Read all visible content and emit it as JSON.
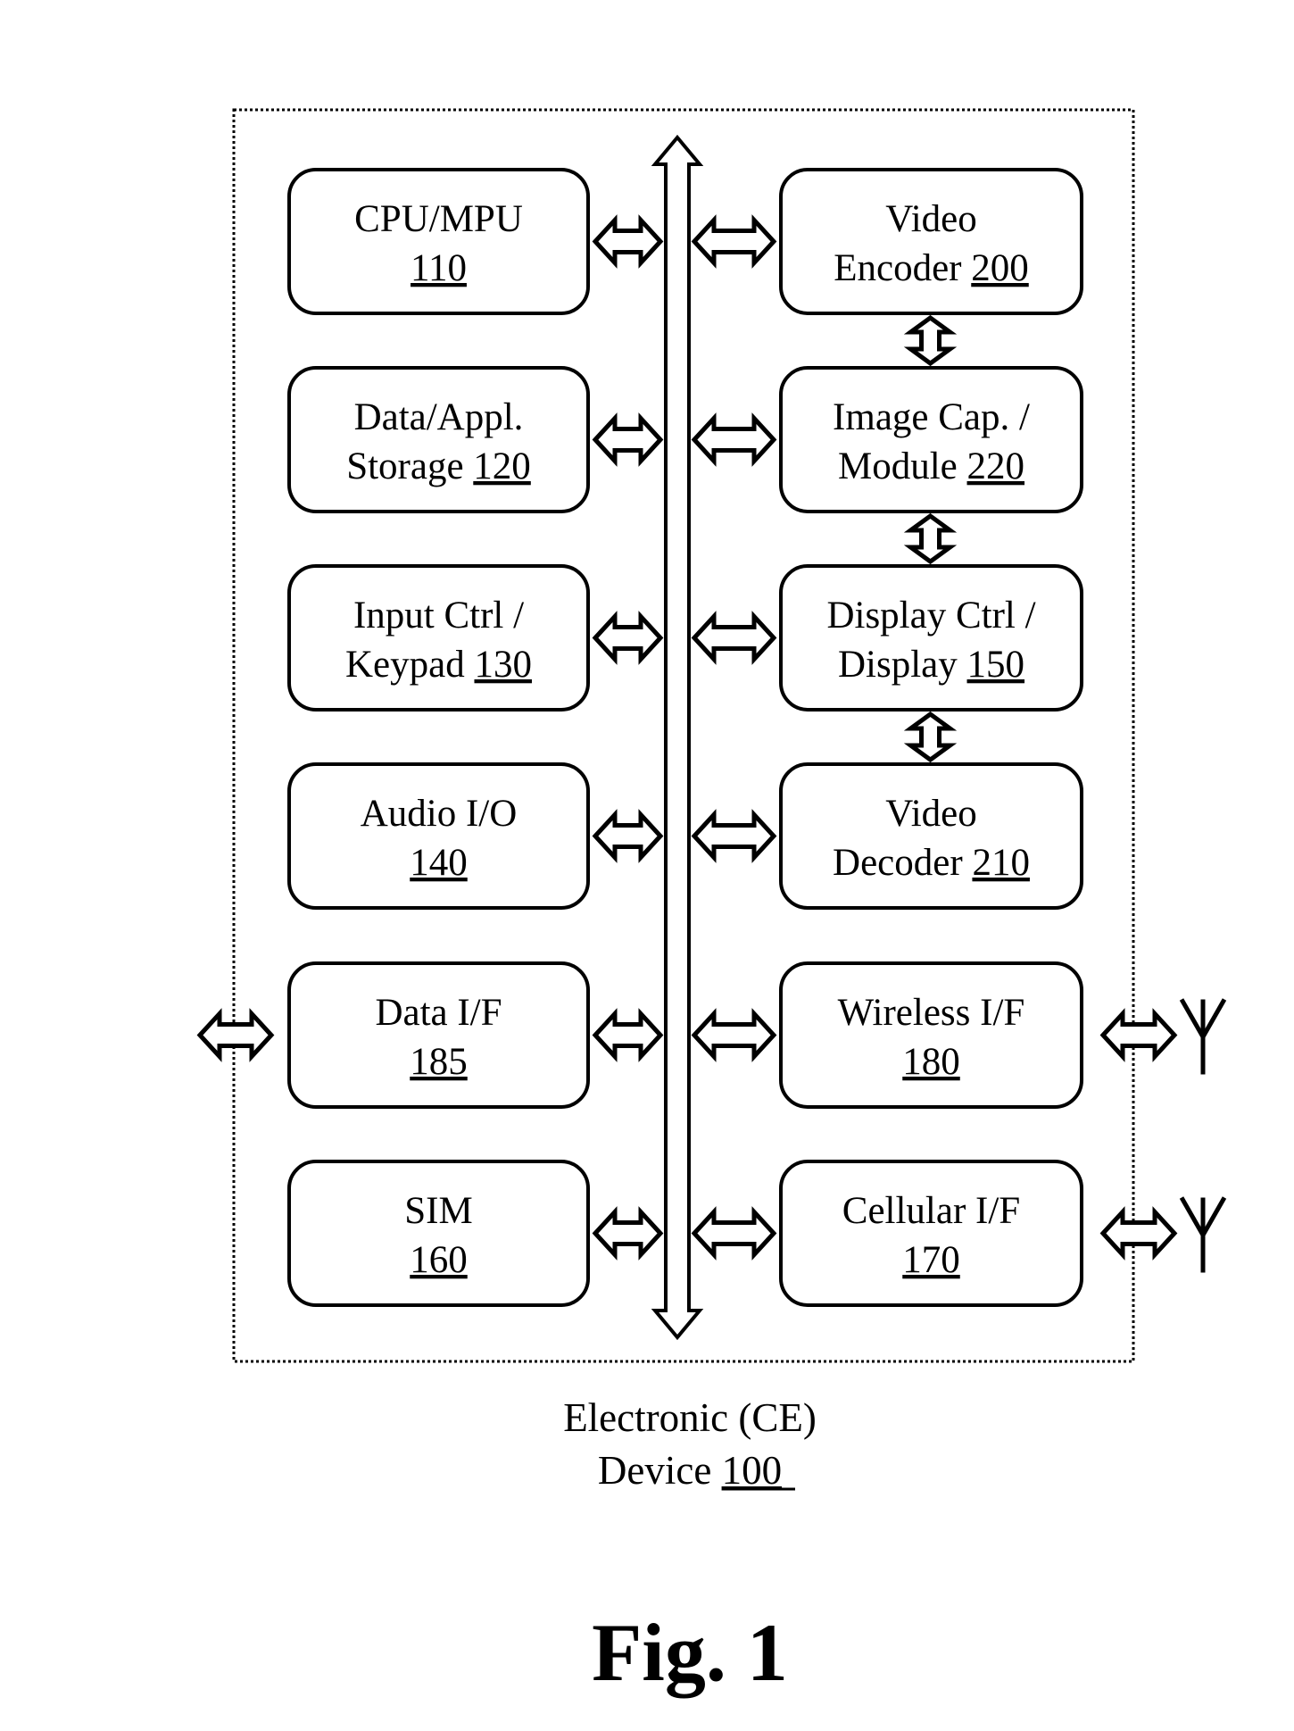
{
  "figure": {
    "title": "Fig. 1",
    "device_caption": {
      "line1": "Electronic (CE)",
      "line2_text": "Device ",
      "line2_ref": "100"
    }
  },
  "blocks": {
    "left": [
      {
        "id": "cpu",
        "line1": "CPU/MPU",
        "line2_text": "",
        "ref": "110"
      },
      {
        "id": "storage",
        "line1": "Data/Appl.",
        "line2_text": "Storage ",
        "ref": "120"
      },
      {
        "id": "input",
        "line1": "Input Ctrl /",
        "line2_text": "Keypad ",
        "ref": "130"
      },
      {
        "id": "audio",
        "line1": "Audio I/O",
        "line2_text": "",
        "ref": "140"
      },
      {
        "id": "data-if",
        "line1": "Data I/F",
        "line2_text": "",
        "ref": "185",
        "external_arrow": "left"
      },
      {
        "id": "sim",
        "line1": "SIM",
        "line2_text": "",
        "ref": "160"
      }
    ],
    "right": [
      {
        "id": "video-encoder",
        "line1": "Video",
        "line2_text": "Encoder ",
        "ref": "200"
      },
      {
        "id": "image-capture",
        "line1": "Image Cap. /",
        "line2_text": "Module ",
        "ref": "220"
      },
      {
        "id": "display",
        "line1": "Display Ctrl /",
        "line2_text": "Display ",
        "ref": "150"
      },
      {
        "id": "video-decoder",
        "line1": "Video",
        "line2_text": "Decoder ",
        "ref": "210"
      },
      {
        "id": "wireless",
        "line1": "Wireless I/F",
        "line2_text": "",
        "ref": "180",
        "antenna": true
      },
      {
        "id": "cellular",
        "line1": "Cellular I/F",
        "line2_text": "",
        "ref": "170",
        "antenna": true
      }
    ],
    "vertical_links": [
      [
        "video-encoder",
        "image-capture"
      ],
      [
        "image-capture",
        "display"
      ],
      [
        "display",
        "video-decoder"
      ]
    ]
  },
  "icons": {
    "bus": "bidirectional-bus-arrow",
    "link": "double-headed-arrow",
    "antenna": "antenna-icon"
  }
}
